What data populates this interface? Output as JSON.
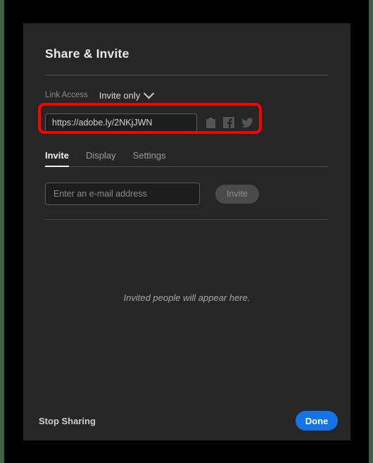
{
  "dialog": {
    "title": "Share & Invite",
    "link_access": {
      "label": "Link Access",
      "value": "Invite only",
      "chevron_icon": "chevron-down-icon"
    },
    "share_link": {
      "url": "https://adobe.ly/2NKjJWN",
      "icons": [
        {
          "name": "clipboard-icon",
          "label": "Copy link"
        },
        {
          "name": "facebook-icon",
          "label": "Share on Facebook"
        },
        {
          "name": "twitter-icon",
          "label": "Share on Twitter"
        }
      ]
    },
    "tabs": [
      {
        "label": "Invite",
        "active": true
      },
      {
        "label": "Display",
        "active": false
      },
      {
        "label": "Settings",
        "active": false
      }
    ],
    "invite": {
      "email_placeholder": "Enter an e-mail address",
      "email_value": "",
      "button_label": "Invite",
      "button_disabled": true
    },
    "empty_state": "Invited people will appear here.",
    "footer": {
      "stop_sharing_label": "Stop Sharing",
      "done_label": "Done"
    }
  },
  "annotation": {
    "highlight_color": "#ff0000",
    "highlight_target": "share-link-row"
  },
  "colors": {
    "panel_bg": "#262626",
    "page_bg": "#000000",
    "edge_strip": "#3f5f42",
    "accent_blue": "#1473e6",
    "text_primary": "#e9e9e9",
    "text_muted": "#8c8c8c"
  }
}
